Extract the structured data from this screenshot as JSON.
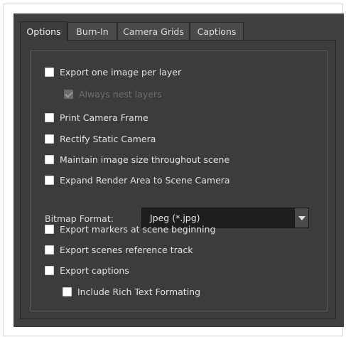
{
  "tabs": [
    {
      "label": "Options",
      "active": true
    },
    {
      "label": "Burn-In",
      "active": false
    },
    {
      "label": "Camera Grids",
      "active": false
    },
    {
      "label": "Captions",
      "active": false
    }
  ],
  "options": {
    "export_one_image_per_layer": {
      "label": "Export one image per layer",
      "checked": false
    },
    "always_nest_layers": {
      "label": "Always nest layers",
      "checked": true,
      "enabled": false
    },
    "print_camera_frame": {
      "label": "Print Camera Frame",
      "checked": false
    },
    "rectify_static_camera": {
      "label": "Rectify Static Camera",
      "checked": false
    },
    "maintain_image_size": {
      "label": "Maintain image size throughout scene",
      "checked": false
    },
    "expand_render_area": {
      "label": "Expand Render Area to Scene Camera",
      "checked": false
    },
    "bitmap_format": {
      "label": "Bitmap Format:",
      "value": "Jpeg (*.jpg)"
    },
    "export_markers": {
      "label": "Export markers at scene beginning",
      "checked": false
    },
    "export_scenes_reference": {
      "label": "Export scenes reference track",
      "checked": false
    },
    "export_captions": {
      "label": "Export captions",
      "checked": false
    },
    "include_rich_text": {
      "label": "Include Rich Text Formating",
      "checked": false
    }
  },
  "colors": {
    "panel": "#3c3c3c",
    "window": "#404040",
    "text": "#e2e2e2",
    "disabled_text": "#6e6e6e"
  }
}
